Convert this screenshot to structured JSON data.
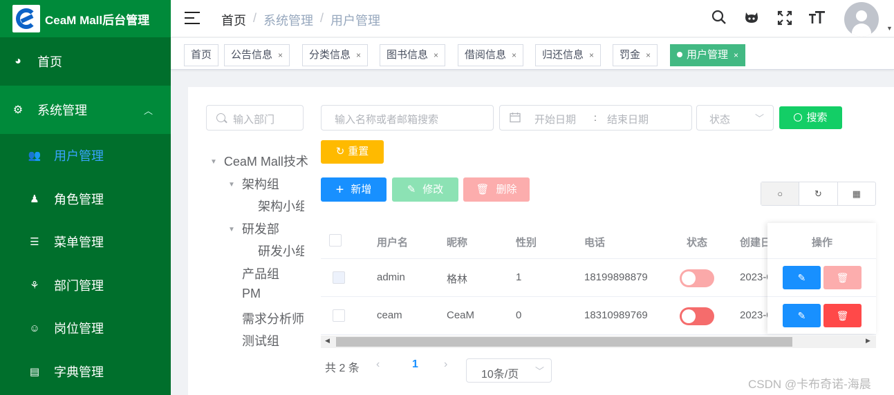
{
  "app": {
    "title": "CeaM Mall后台管理"
  },
  "sidebar": {
    "top_items": [
      {
        "label": "首页",
        "icon": "dashboard-icon"
      },
      {
        "label": "系统管理",
        "icon": "gear-icon"
      }
    ],
    "sub_items": [
      {
        "label": "用户管理",
        "icon": "users-icon",
        "active": true
      },
      {
        "label": "角色管理",
        "icon": "role-icon"
      },
      {
        "label": "菜单管理",
        "icon": "list-icon"
      },
      {
        "label": "部门管理",
        "icon": "org-tree-icon"
      },
      {
        "label": "岗位管理",
        "icon": "post-icon"
      },
      {
        "label": "字典管理",
        "icon": "dictionary-icon"
      }
    ]
  },
  "header": {
    "breadcrumb": [
      "首页",
      "系统管理",
      "用户管理"
    ],
    "separator": "/",
    "icons": [
      "search-icon",
      "github-icon",
      "fullscreen-icon",
      "text-size-icon"
    ]
  },
  "tags": [
    {
      "label": "首页",
      "closable": false
    },
    {
      "label": "公告信息",
      "closable": true
    },
    {
      "label": "分类信息",
      "closable": true
    },
    {
      "label": "图书信息",
      "closable": true
    },
    {
      "label": "借阅信息",
      "closable": true
    },
    {
      "label": "归还信息",
      "closable": true
    },
    {
      "label": "罚金",
      "closable": true
    },
    {
      "label": "用户管理",
      "closable": true,
      "active": true
    }
  ],
  "dept_filter": {
    "placeholder": "输入部门"
  },
  "tree": [
    {
      "label": "CeaM Mall技术",
      "expanded": true
    },
    {
      "label": "架构组",
      "expanded": true
    },
    {
      "label": "架构小组"
    },
    {
      "label": "研发部",
      "expanded": true
    },
    {
      "label": "研发小组"
    },
    {
      "label": "产品组"
    },
    {
      "label": "PM"
    },
    {
      "label": "需求分析师"
    },
    {
      "label": "测试组"
    }
  ],
  "filters": {
    "keyword_placeholder": "输入名称或者邮箱搜索",
    "start_date_placeholder": "开始日期",
    "date_separator": ":",
    "end_date_placeholder": "结束日期",
    "status_placeholder": "状态",
    "search_label": "搜索",
    "reset_label": "重置"
  },
  "actions": {
    "add": "新增",
    "edit": "修改",
    "delete": "删除"
  },
  "table": {
    "columns": [
      "用户名",
      "昵称",
      "性别",
      "电话",
      "状态",
      "创建日",
      "操作"
    ],
    "rows": [
      {
        "username": "admin",
        "nickname": "格林",
        "gender": "1",
        "phone": "18199898879",
        "enabled": false,
        "created": "2023-0"
      },
      {
        "username": "ceam",
        "nickname": "CeaM",
        "gender": "0",
        "phone": "18310989769",
        "enabled": false,
        "created": "2023-0"
      }
    ]
  },
  "pagination": {
    "total": "共 2 条",
    "current": "1",
    "page_size": "10条/页"
  },
  "watermark": "CSDN @卡布奇诺-海晨",
  "colors": {
    "sidebar": "#006f2c",
    "sidebar_active_bg": "#008a3a",
    "active_text": "#3aa4ff",
    "tag_active": "#42b983",
    "primary": "#1890ff",
    "success": "#13ce66",
    "warning": "#ffba00",
    "danger": "#ff4949"
  }
}
